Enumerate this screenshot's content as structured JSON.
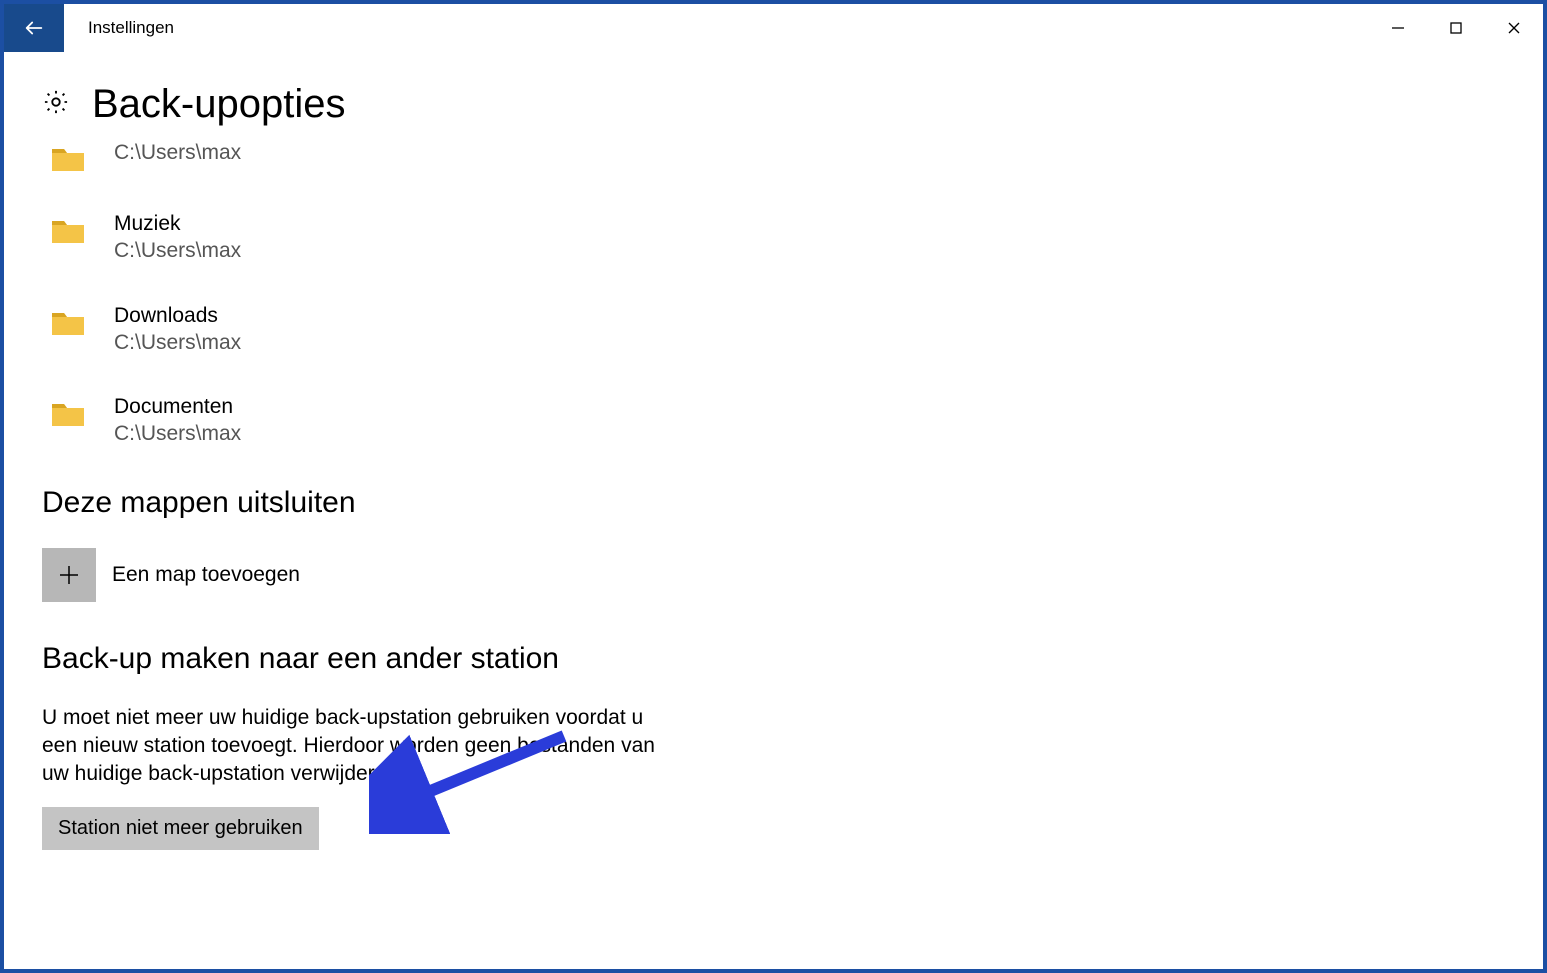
{
  "titlebar": {
    "title": "Instellingen"
  },
  "page": {
    "heading": "Back-upopties"
  },
  "folders": [
    {
      "name": "",
      "path": "C:\\Users\\max"
    },
    {
      "name": "Muziek",
      "path": "C:\\Users\\max"
    },
    {
      "name": "Downloads",
      "path": "C:\\Users\\max"
    },
    {
      "name": "Documenten",
      "path": "C:\\Users\\max"
    }
  ],
  "exclude": {
    "heading": "Deze mappen uitsluiten",
    "add_label": "Een map toevoegen"
  },
  "other_drive": {
    "heading": "Back-up maken naar een ander station",
    "description": "U moet niet meer uw huidige back-upstation gebruiken voordat u een nieuw station toevoegt. Hierdoor worden geen bestanden van uw huidige back-upstation verwijderd",
    "button": "Station niet meer gebruiken"
  }
}
